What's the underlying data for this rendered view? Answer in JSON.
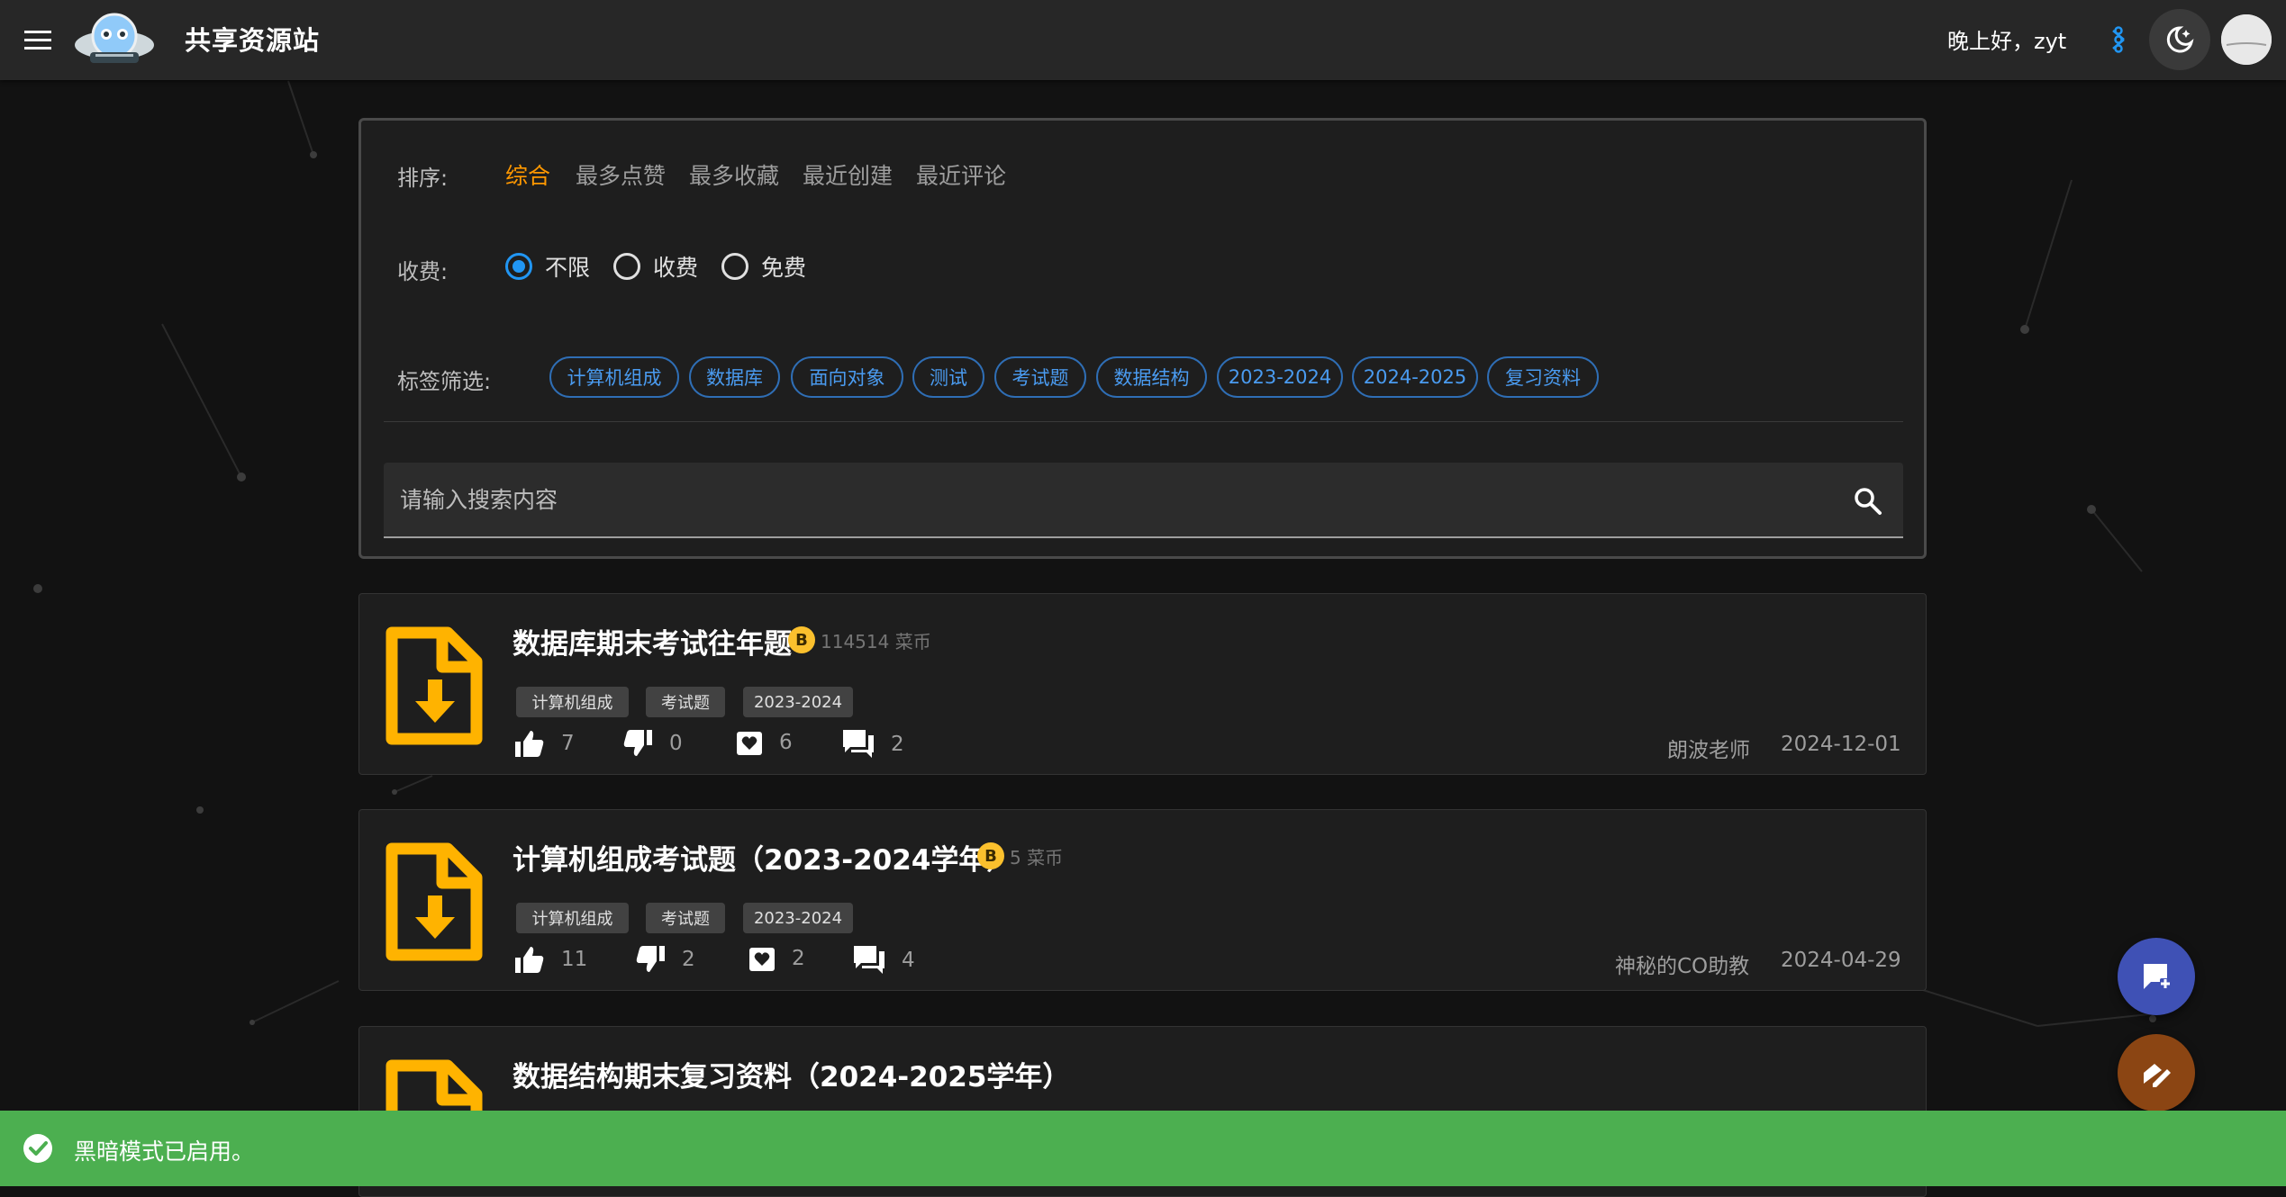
{
  "header": {
    "site_title": "共享资源站",
    "greeting": "晚上好，zyt"
  },
  "filters": {
    "sort_label": "排序:",
    "sort_options": [
      "综合",
      "最多点赞",
      "最多收藏",
      "最近创建",
      "最近评论"
    ],
    "sort_active": "综合",
    "fee_label": "收费:",
    "fee_options": [
      "不限",
      "收费",
      "免费"
    ],
    "fee_selected": "不限",
    "tag_label": "标签筛选:",
    "tags": [
      "计算机组成",
      "数据库",
      "面向对象",
      "测试",
      "考试题",
      "数据结构",
      "2023-2024",
      "2024-2025",
      "复习资料"
    ],
    "search_placeholder": "请输入搜索内容"
  },
  "resources": [
    {
      "title": "数据库期末考试往年题",
      "price": "114514 菜币",
      "tags": [
        "计算机组成",
        "考试题",
        "2023-2024"
      ],
      "likes": "7",
      "dislikes": "0",
      "favorites": "6",
      "comments": "2",
      "author": "朗波老师",
      "date": "2024-12-01"
    },
    {
      "title": "计算机组成考试题（2023-2024学年）",
      "price": "5 菜币",
      "tags": [
        "计算机组成",
        "考试题",
        "2023-2024"
      ],
      "likes": "11",
      "dislikes": "2",
      "favorites": "2",
      "comments": "4",
      "author": "神秘的CO助教",
      "date": "2024-04-29"
    },
    {
      "title": "数据结构期末复习资料（2024-2025学年）"
    }
  ],
  "snackbar": {
    "message": "黑暗模式已启用。"
  },
  "colors": {
    "accent_orange": "#ff9800",
    "chip_blue": "#2f6eb5",
    "radio_blue": "#2196f3",
    "file_icon_yellow": "#ffb300",
    "coin_yellow": "#fbc02d",
    "snackbar_green": "#4caf50",
    "fab_indigo": "#3f51b5",
    "fab_brown": "#8b4513"
  },
  "icons": [
    "menu-icon",
    "logo",
    "palette-icon",
    "dark-mode-icon",
    "avatar",
    "search-icon",
    "file-download-icon",
    "coin-icon",
    "thumb-up-icon",
    "thumb-down-icon",
    "favorite-box-icon",
    "comments-icon",
    "add-post-icon",
    "edit-icon",
    "check-circle-icon"
  ]
}
